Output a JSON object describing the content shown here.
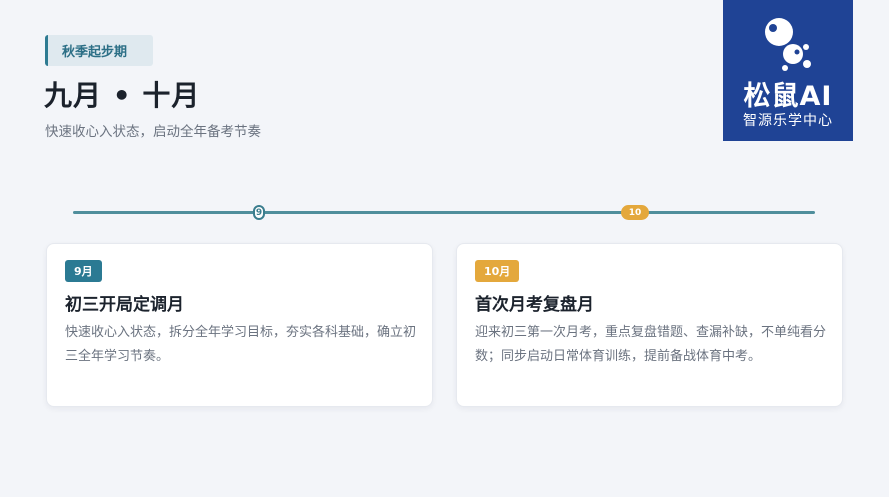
{
  "header": {
    "tag": "秋季起步期",
    "title": "九月 • 十月",
    "subtitle": "快速收心入状态，启动全年备考节奏"
  },
  "logo": {
    "brand": "松鼠AI",
    "sub": "智源乐学中心",
    "color": "#1f4395"
  },
  "timeline": {
    "markers": [
      {
        "label": "9"
      },
      {
        "label": "10"
      }
    ]
  },
  "cards": [
    {
      "badge": "9月",
      "title": "初三开局定调月",
      "desc": "快速收心入状态，拆分全年学习目标，夯实各科基础，确立初三全年学习节奏。",
      "accent": "#2b7a93"
    },
    {
      "badge": "10月",
      "title": "首次月考复盘月",
      "desc": "迎来初三第一次月考，重点复盘错题、查漏补缺，不单纯看分数；同步启动日常体育训练，提前备战体育中考。",
      "accent": "#e4a83c"
    }
  ]
}
